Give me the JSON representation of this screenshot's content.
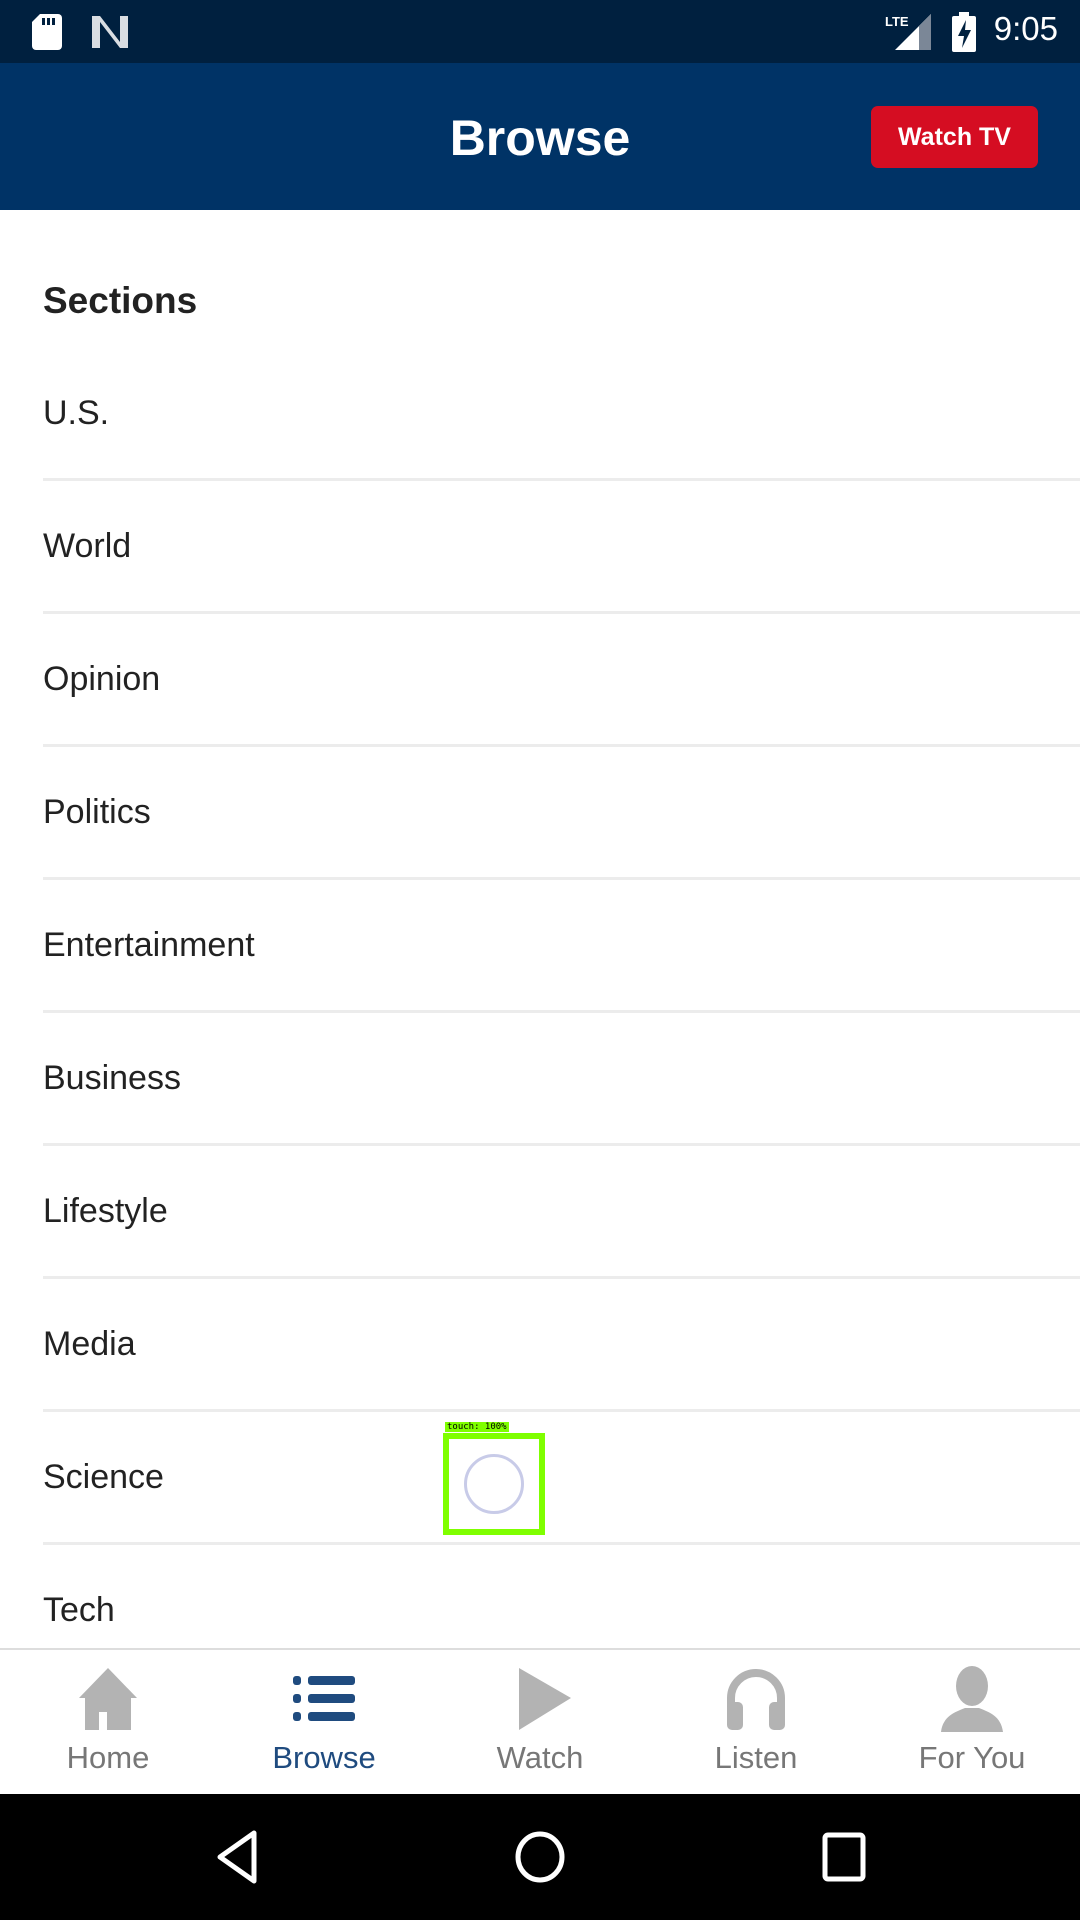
{
  "status_bar": {
    "time": "9:05",
    "network": "LTE"
  },
  "header": {
    "title": "Browse",
    "watch_tv_label": "Watch TV"
  },
  "sections": {
    "title": "Sections",
    "items": [
      "U.S.",
      "World",
      "Opinion",
      "Politics",
      "Entertainment",
      "Business",
      "Lifestyle",
      "Media",
      "Science",
      "Tech"
    ]
  },
  "bottom_nav": {
    "items": [
      {
        "label": "Home",
        "icon": "home-icon"
      },
      {
        "label": "Browse",
        "icon": "list-icon",
        "active": true
      },
      {
        "label": "Watch",
        "icon": "play-icon"
      },
      {
        "label": "Listen",
        "icon": "headphones-icon"
      },
      {
        "label": "For You",
        "icon": "person-icon"
      }
    ]
  },
  "touch_overlay": {
    "label": "touch: 100%"
  },
  "colors": {
    "header": "#003366",
    "accent": "#d50d22",
    "active_tab": "#1f4b7f"
  }
}
